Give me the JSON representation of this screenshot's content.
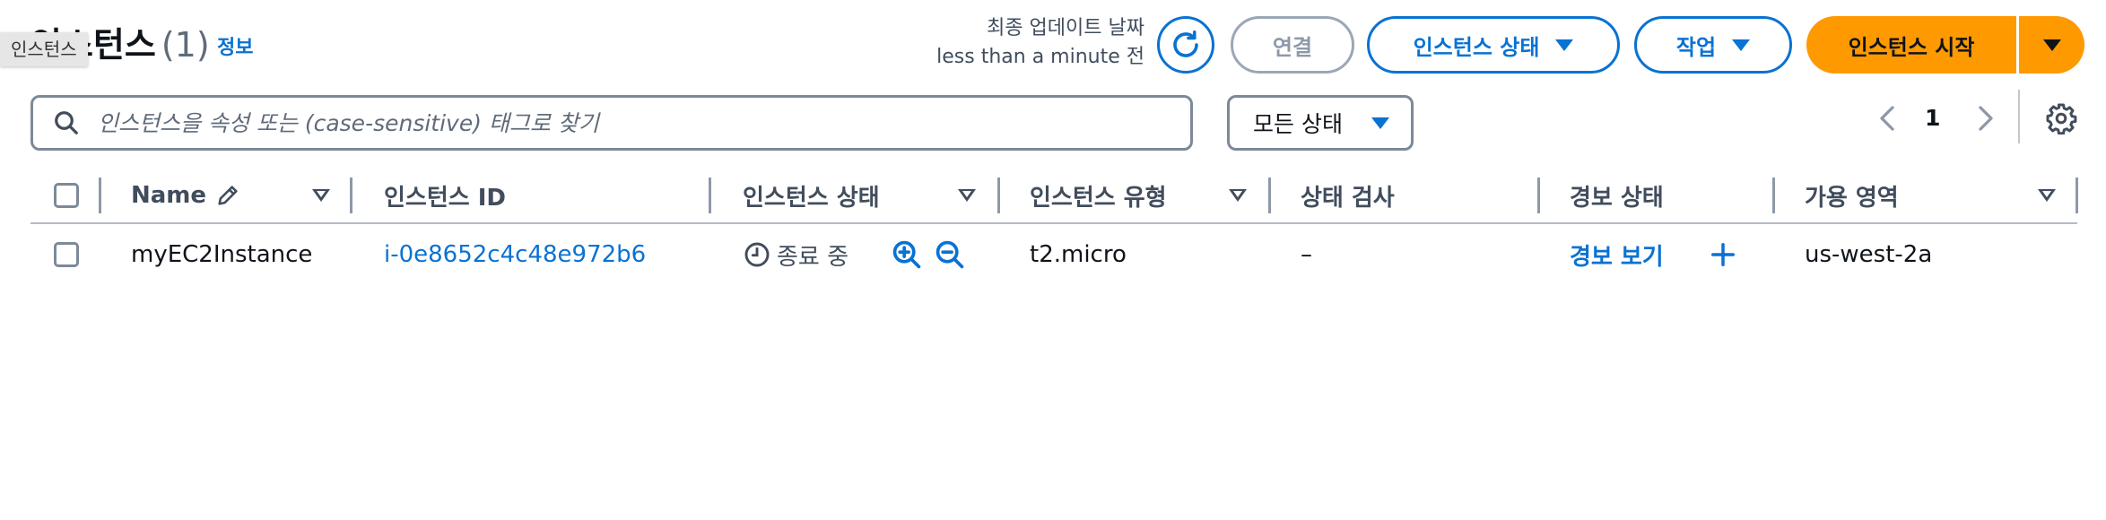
{
  "header": {
    "title": "인스턴스",
    "count": "(1)",
    "info_link": "정보",
    "tooltip": "인스턴스",
    "last_updated_label": "최종 업데이트 날짜",
    "last_updated_value": "less than a minute 전"
  },
  "toolbar": {
    "connect_label": "연결",
    "instance_state_label": "인스턴스 상태",
    "actions_label": "작업",
    "launch_label": "인스턴스 시작"
  },
  "filter": {
    "search_placeholder": "인스턴스을 속성 또는 (case-sensitive) 태그로 찾기",
    "status_select": "모든 상태"
  },
  "pagination": {
    "current_page": "1"
  },
  "table": {
    "columns": [
      "Name",
      "인스턴스 ID",
      "인스턴스 상태",
      "인스턴스 유형",
      "상태 검사",
      "경보 상태",
      "가용 영역"
    ],
    "rows": [
      {
        "name": "myEC2Instance",
        "instance_id": "i-0e8652c4c48e972b6",
        "state": "종료 중",
        "type": "t2.micro",
        "status_check": "–",
        "alarm": "경보 보기",
        "az": "us-west-2a"
      }
    ]
  },
  "colors": {
    "link": "#0972d3",
    "primary": "#ff9900",
    "disabled": "#8d99a8"
  }
}
